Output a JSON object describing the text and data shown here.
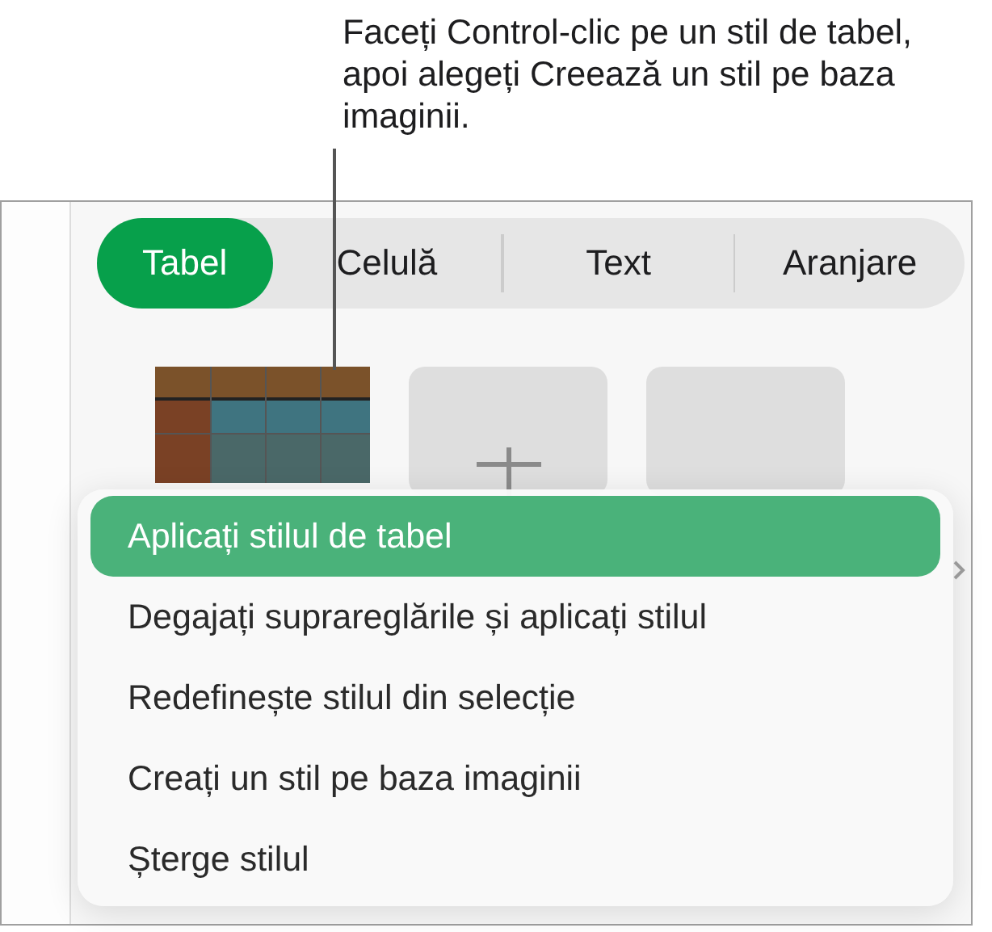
{
  "callout": {
    "text": "Faceți Control-clic pe un stil de tabel, apoi alegeți Creează un stil pe baza imaginii."
  },
  "tabs": [
    {
      "label": "Tabel",
      "selected": true
    },
    {
      "label": "Celulă",
      "selected": false
    },
    {
      "label": "Text",
      "selected": false
    },
    {
      "label": "Aranjare",
      "selected": false
    }
  ],
  "styles": [
    {
      "kind": "table"
    },
    {
      "kind": "add"
    },
    {
      "kind": "empty"
    }
  ],
  "menu": {
    "items": [
      {
        "label": "Aplicați stilul de tabel",
        "selected": true
      },
      {
        "label": "Degajați suprareglările și aplicați stilul",
        "selected": false
      },
      {
        "label": "Redefinește stilul din selecție",
        "selected": false
      },
      {
        "label": "Creați un stil pe baza imaginii",
        "selected": false
      },
      {
        "label": "Șterge stilul",
        "selected": false
      }
    ]
  }
}
